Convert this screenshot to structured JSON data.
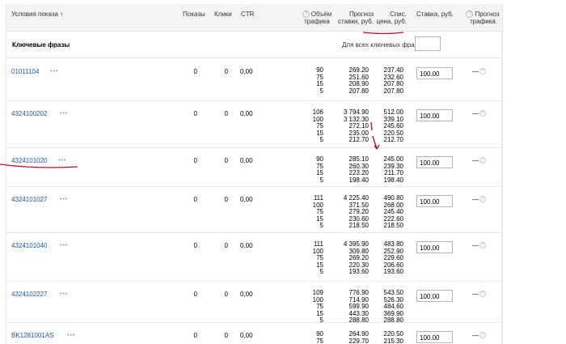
{
  "headers": {
    "conditions": "Условия показа ↑",
    "impressions": "Показы",
    "clicks": "Клики",
    "ctr": "CTR",
    "traffic_volume_1": "Объём",
    "traffic_volume_2": "трафика",
    "bid_forecast_1": "Прогноз",
    "bid_forecast_2": "ставки, руб.",
    "list_price_1": "Спис.",
    "list_price_2": "цена, руб.",
    "bid": "Ставка, руб.",
    "traffic_forecast_1": "Прогноз",
    "traffic_forecast_2": "трафика"
  },
  "keywords_title": "Ключевые фразы",
  "all_phrases_label": "Для всех ключевых фраз:",
  "rows": [
    {
      "phrase": "01011104",
      "impressions": "0",
      "clicks": "0",
      "ctr": "0,00",
      "volume": "90\n75\n15\n5",
      "forecast": "269.20\n251.60\n208.90\n207.80",
      "list_price": "237.40\n232.60\n207.80\n207.80",
      "bid": "100.00",
      "traffic": "—"
    },
    {
      "phrase": "4324100202",
      "impressions": "0",
      "clicks": "0",
      "ctr": "0,00",
      "volume": "106\n100\n75\n15\n5",
      "forecast": "3 794.90\n3 132.30\n272.10\n235.00\n212.70",
      "list_price": "512.00\n339.10\n245.60\n220.50\n212.70",
      "bid": "100.00",
      "traffic": "—"
    },
    {
      "phrase": "4324101020",
      "impressions": "0",
      "clicks": "0",
      "ctr": "0,00",
      "volume": "90\n75\n15\n5",
      "forecast": "285.10\n260.30\n223.20\n198.40",
      "list_price": "245.00\n239.30\n211.70\n198.40",
      "bid": "100.00",
      "traffic": "—"
    },
    {
      "phrase": "4324101027",
      "impressions": "0",
      "clicks": "0",
      "ctr": "0,00",
      "volume": "111\n100\n75\n15\n5",
      "forecast": "4 225.40\n371.50\n279.20\n230.60\n218.50",
      "list_price": "490.80\n268.00\n245.40\n222.60\n218.50",
      "bid": "100.00",
      "traffic": "—"
    },
    {
      "phrase": "4324101040",
      "impressions": "0",
      "clicks": "0",
      "ctr": "0,00",
      "volume": "111\n100\n75\n15\n5",
      "forecast": "4 395.90\n309.80\n269.20\n220.30\n193.60",
      "list_price": "483.80\n252.90\n229.60\n206.60\n193.60",
      "bid": "100.00",
      "traffic": "—"
    },
    {
      "phrase": "4324102227",
      "impressions": "0",
      "clicks": "0",
      "ctr": "0,00",
      "volume": "109\n100\n75\n15\n5",
      "forecast": "776.90\n714.90\n599.90\n443.30\n288.80",
      "list_price": "543.50\n526.30\n484.60\n369.90\n288.80",
      "bid": "100.00",
      "traffic": "—"
    },
    {
      "phrase": "BK1281001AS",
      "impressions": "0",
      "clicks": "0",
      "ctr": "0,00",
      "volume": "90\n75",
      "forecast": "264.90\n229.70",
      "list_price": "220.50\n215.30",
      "bid": "100.00",
      "traffic": "—"
    }
  ],
  "all_bid_value": "",
  "colors": {
    "link": "#1a58a8",
    "annotation": "#d0021b"
  },
  "icons": {
    "help": "question-circle-icon",
    "more": "more-dots-icon"
  }
}
